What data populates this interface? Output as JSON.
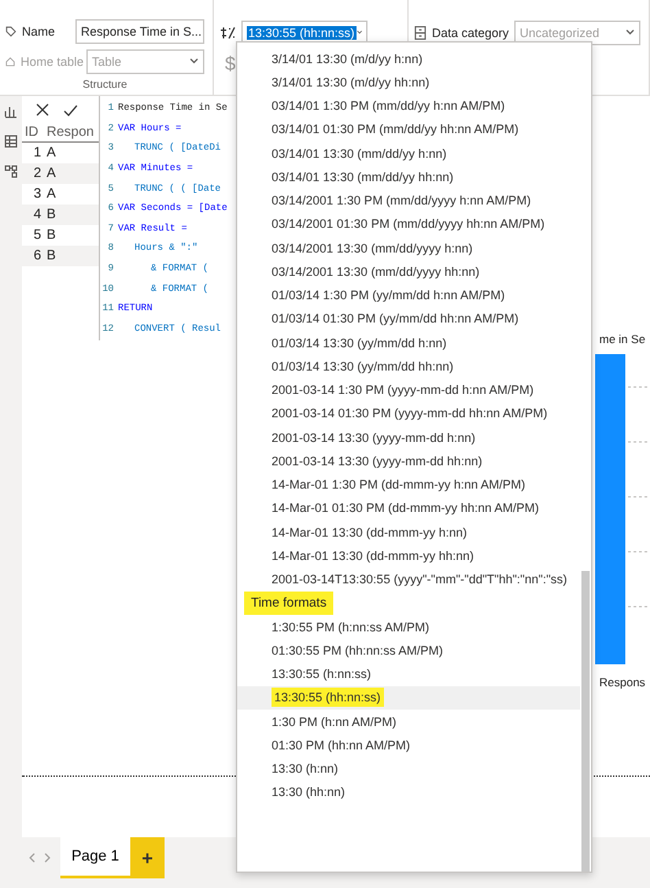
{
  "ribbon": {
    "structure": {
      "name_label": "Name",
      "name_value": "Response Time in S...",
      "home_table_label": "Home table",
      "home_table_value": "Table",
      "home_table_disabled": true,
      "group_label": "Structure"
    },
    "formatting": {
      "format_value": "13:30:55 (hh:nn:ss)",
      "currency_symbol": "$",
      "currency_disabled": true
    },
    "properties": {
      "data_category_label": "Data category",
      "data_category_value": "Uncategorized",
      "data_category_disabled": true
    }
  },
  "formula_bar": {
    "lines": [
      {
        "number": "1",
        "text": "Response Time in Se",
        "kind": "top"
      },
      {
        "number": "2",
        "text": "VAR Hours =",
        "kind": "var"
      },
      {
        "number": "3",
        "text": "TRUNC ( [DateDi",
        "kind": "inner"
      },
      {
        "number": "4",
        "text": "VAR Minutes =",
        "kind": "var"
      },
      {
        "number": "5",
        "text": "TRUNC ( ( [Date",
        "kind": "inner"
      },
      {
        "number": "6",
        "text": "VAR Seconds = [Date",
        "kind": "var"
      },
      {
        "number": "7",
        "text": "VAR Result =",
        "kind": "var"
      },
      {
        "number": "8",
        "text": "Hours & \":\"",
        "kind": "inner"
      },
      {
        "number": "9",
        "text": "& FORMAT (",
        "kind": "deep"
      },
      {
        "number": "10",
        "text": "& FORMAT (",
        "kind": "deep"
      },
      {
        "number": "11",
        "text": "RETURN",
        "kind": "var"
      },
      {
        "number": "12",
        "text": "CONVERT ( Resul",
        "kind": "inner"
      }
    ]
  },
  "table": {
    "columns": [
      "ID",
      "Respon"
    ],
    "rows": [
      [
        "1",
        "A"
      ],
      [
        "2",
        "A"
      ],
      [
        "3",
        "A"
      ],
      [
        "4",
        "B"
      ],
      [
        "5",
        "B"
      ],
      [
        "6",
        "B"
      ]
    ]
  },
  "chart": {
    "title": "me in Se",
    "axis_label": "Respons"
  },
  "page_tabs": {
    "tabs": [
      {
        "label": "Page 1",
        "selected": true
      }
    ],
    "add_button": "+"
  },
  "format_dropdown": {
    "items": [
      {
        "kind": "option",
        "label": "3/14/01 13:30 (m/d/yy h:nn)",
        "selected": false
      },
      {
        "kind": "option",
        "label": "3/14/01 13:30 (m/d/yy hh:nn)",
        "selected": false
      },
      {
        "kind": "option",
        "label": "03/14/01 1:30 PM (mm/dd/yy h:nn AM/PM)",
        "selected": false
      },
      {
        "kind": "option",
        "label": "03/14/01 01:30 PM (mm/dd/yy hh:nn AM/PM)",
        "selected": false
      },
      {
        "kind": "option",
        "label": "03/14/01 13:30 (mm/dd/yy h:nn)",
        "selected": false
      },
      {
        "kind": "option",
        "label": "03/14/01 13:30 (mm/dd/yy hh:nn)",
        "selected": false
      },
      {
        "kind": "option",
        "label": "03/14/2001 1:30 PM (mm/dd/yyyy h:nn AM/PM)",
        "selected": false
      },
      {
        "kind": "option",
        "label": "03/14/2001 01:30 PM (mm/dd/yyyy hh:nn AM/PM)",
        "selected": false
      },
      {
        "kind": "option",
        "label": "03/14/2001 13:30 (mm/dd/yyyy h:nn)",
        "selected": false
      },
      {
        "kind": "option",
        "label": "03/14/2001 13:30 (mm/dd/yyyy hh:nn)",
        "selected": false
      },
      {
        "kind": "option",
        "label": "01/03/14 1:30 PM (yy/mm/dd h:nn AM/PM)",
        "selected": false
      },
      {
        "kind": "option",
        "label": "01/03/14 01:30 PM (yy/mm/dd hh:nn AM/PM)",
        "selected": false
      },
      {
        "kind": "option",
        "label": "01/03/14 13:30 (yy/mm/dd h:nn)",
        "selected": false
      },
      {
        "kind": "option",
        "label": "01/03/14 13:30 (yy/mm/dd hh:nn)",
        "selected": false
      },
      {
        "kind": "option",
        "label": "2001-03-14 1:30 PM (yyyy-mm-dd h:nn AM/PM)",
        "selected": false
      },
      {
        "kind": "option",
        "label": "2001-03-14 01:30 PM (yyyy-mm-dd hh:nn AM/PM)",
        "selected": false
      },
      {
        "kind": "option",
        "label": "2001-03-14 13:30 (yyyy-mm-dd h:nn)",
        "selected": false
      },
      {
        "kind": "option",
        "label": "2001-03-14 13:30 (yyyy-mm-dd hh:nn)",
        "selected": false
      },
      {
        "kind": "option",
        "label": "14-Mar-01 1:30 PM (dd-mmm-yy h:nn AM/PM)",
        "selected": false
      },
      {
        "kind": "option",
        "label": "14-Mar-01 01:30 PM (dd-mmm-yy hh:nn AM/PM)",
        "selected": false
      },
      {
        "kind": "option",
        "label": "14-Mar-01 13:30 (dd-mmm-yy h:nn)",
        "selected": false
      },
      {
        "kind": "option",
        "label": "14-Mar-01 13:30 (dd-mmm-yy hh:nn)",
        "selected": false
      },
      {
        "kind": "option",
        "label": "2001-03-14T13:30:55 (yyyy\"-\"mm\"-\"dd\"T\"hh\":\"nn\":\"ss)",
        "selected": false
      },
      {
        "kind": "header",
        "label": "Time formats"
      },
      {
        "kind": "option",
        "label": "1:30:55 PM (h:nn:ss AM/PM)",
        "selected": false
      },
      {
        "kind": "option",
        "label": "01:30:55 PM (hh:nn:ss AM/PM)",
        "selected": false
      },
      {
        "kind": "option",
        "label": "13:30:55 (h:nn:ss)",
        "selected": false
      },
      {
        "kind": "option",
        "label": "13:30:55 (hh:nn:ss)",
        "selected": true
      },
      {
        "kind": "option",
        "label": "1:30 PM (h:nn AM/PM)",
        "selected": false
      },
      {
        "kind": "option",
        "label": "01:30 PM (hh:nn AM/PM)",
        "selected": false
      },
      {
        "kind": "option",
        "label": "13:30 (h:nn)",
        "selected": false
      },
      {
        "kind": "option",
        "label": "13:30 (hh:nn)",
        "selected": false
      }
    ]
  }
}
